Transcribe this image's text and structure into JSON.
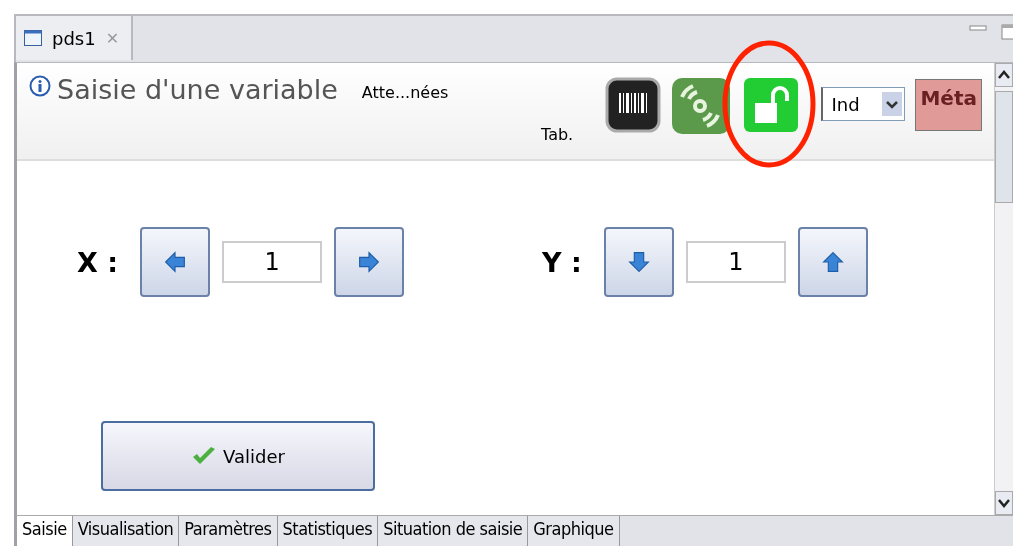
{
  "view_tab": {
    "title": "pds1",
    "close": "✕"
  },
  "header": {
    "title": "Saisie d'une variable",
    "info_label": "Atte...nées",
    "tab_label": "Tab.",
    "dropdown_value": "Ind",
    "meta_button": "Méta"
  },
  "coordinates": [
    {
      "label": "X :",
      "value": "1",
      "kind": "horizontal"
    },
    {
      "label": "Y :",
      "value": "1",
      "kind": "vertical"
    }
  ],
  "validate_button": "Valider",
  "bottom_tabs": [
    {
      "label": "Saisie",
      "selected": true
    },
    {
      "label": "Visualisation",
      "selected": false
    },
    {
      "label": "Paramètres",
      "selected": false
    },
    {
      "label": "Statistiques",
      "selected": false
    },
    {
      "label": "Situation de saisie",
      "selected": false
    },
    {
      "label": "Graphique",
      "selected": false
    }
  ]
}
